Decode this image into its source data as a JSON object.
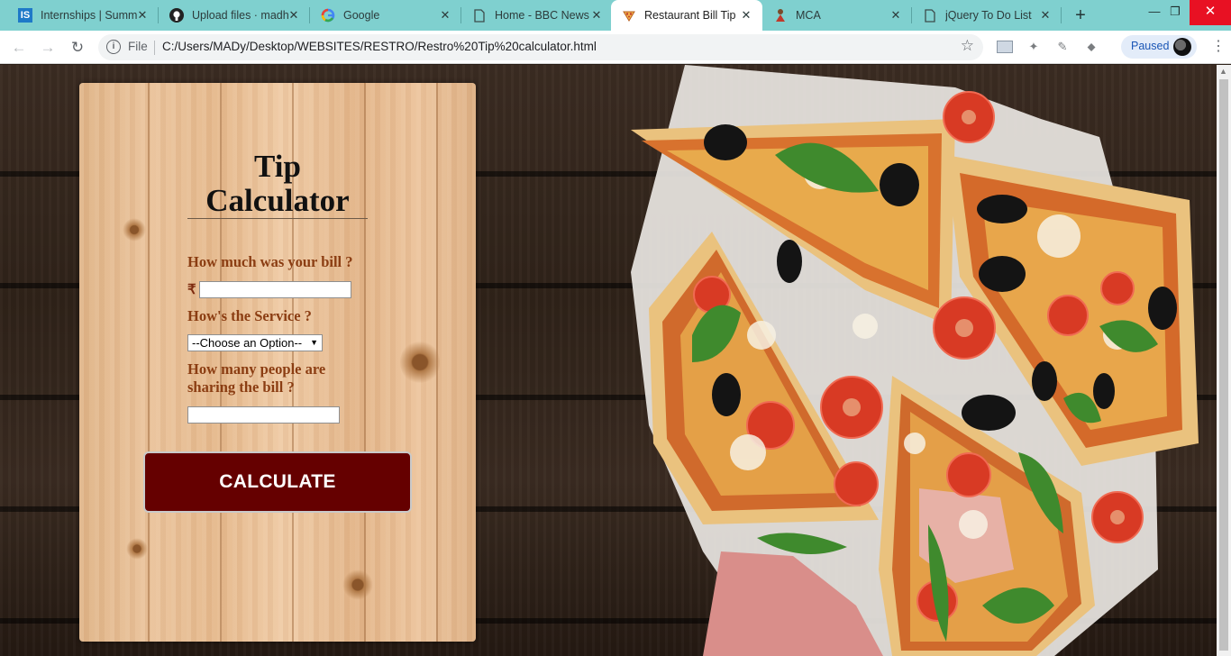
{
  "browser": {
    "tabs": [
      {
        "title": "Internships | Summ",
        "favicon": "internshala-icon"
      },
      {
        "title": "Upload files · madh",
        "favicon": "github-icon"
      },
      {
        "title": "Google",
        "favicon": "google-icon"
      },
      {
        "title": "Home - BBC News",
        "favicon": "page-icon"
      },
      {
        "title": "Restaurant Bill Tip C",
        "favicon": "pizza-icon",
        "active": true
      },
      {
        "title": "MCA",
        "favicon": "person-icon"
      },
      {
        "title": "jQuery To Do List",
        "favicon": "page-icon"
      }
    ],
    "address": {
      "scheme_label": "File",
      "url": "C:/Users/MADy/Desktop/WEBSITES/RESTRO/Restro%20Tip%20calculator.html"
    },
    "profile_status": "Paused",
    "colors": {
      "tabstrip": "#7fd0cf",
      "close_button": "#e81123"
    }
  },
  "calculator": {
    "title_line1": "Tip",
    "title_line2": "Calculator",
    "bill_question": "How much was your bill ?",
    "currency_symbol": "₹",
    "bill_value": "",
    "service_question": "How's the Service ?",
    "service_selected": "--Choose an Option--",
    "people_question_line1": "How many people are",
    "people_question_line2": "sharing the bill ?",
    "people_value": "",
    "calculate_label": "CALCULATE",
    "colors": {
      "question_text": "#8b3d12",
      "button_bg": "#650000"
    }
  }
}
